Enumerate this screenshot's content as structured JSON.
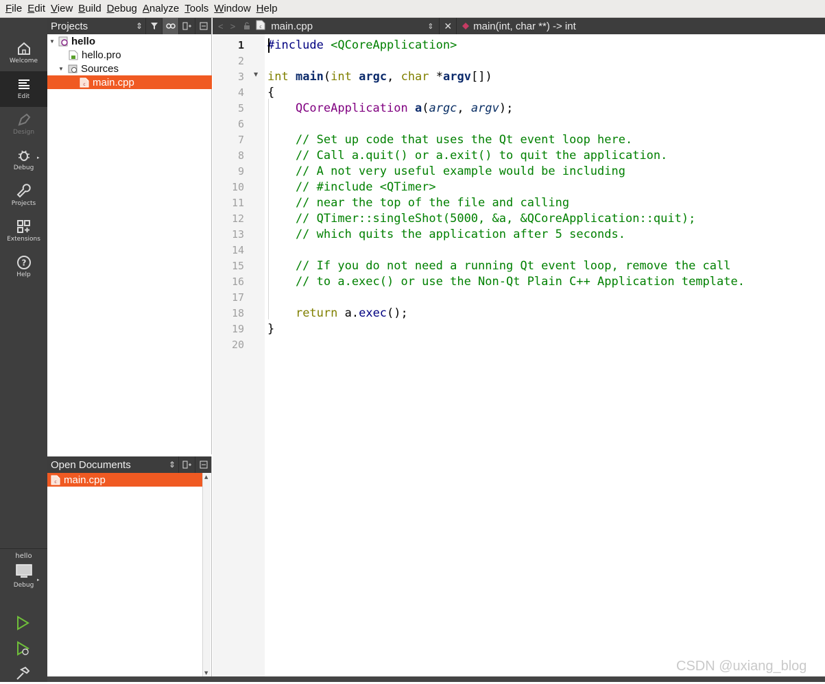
{
  "menubar": {
    "items": [
      "File",
      "Edit",
      "View",
      "Build",
      "Debug",
      "Analyze",
      "Tools",
      "Window",
      "Help"
    ]
  },
  "modes": {
    "welcome": "Welcome",
    "edit": "Edit",
    "design": "Design",
    "debug": "Debug",
    "projects": "Projects",
    "extensions": "Extensions",
    "help": "Help"
  },
  "kit": {
    "project": "hello",
    "build": "Debug"
  },
  "projects_pane": {
    "title": "Projects",
    "tree": [
      {
        "label": "hello",
        "level": 0,
        "expanded": true,
        "bold": true
      },
      {
        "label": "hello.pro",
        "level": 1
      },
      {
        "label": "Sources",
        "level": 1,
        "expanded": true
      },
      {
        "label": "main.cpp",
        "level": 2,
        "selected": true
      }
    ]
  },
  "open_documents": {
    "title": "Open Documents",
    "items": [
      "main.cpp"
    ]
  },
  "editor": {
    "file_name": "main.cpp",
    "symbol": "main(int, char **) -> int",
    "current_line": 1,
    "line_numbers": [
      "1",
      "2",
      "3",
      "4",
      "5",
      "6",
      "7",
      "8",
      "9",
      "10",
      "11",
      "12",
      "13",
      "14",
      "15",
      "16",
      "17",
      "18",
      "19",
      "20"
    ]
  },
  "code": {
    "l1_pp": "#include",
    "l1_inc": " <QCoreApplication>",
    "l3_a": "int",
    "l3_b": " ",
    "l3_c": "main",
    "l3_d": "(",
    "l3_e": "int",
    "l3_f": " ",
    "l3_g": "argc",
    "l3_h": ", ",
    "l3_i": "char",
    "l3_j": " *",
    "l3_k": "argv",
    "l3_l": "[])",
    "l4": "{",
    "l5_a": "    ",
    "l5_b": "QCoreApplication",
    "l5_c": " ",
    "l5_d": "a",
    "l5_e": "(",
    "l5_f": "argc",
    "l5_g": ", ",
    "l5_h": "argv",
    "l5_i": ");",
    "l7": "    // Set up code that uses the Qt event loop here.",
    "l8": "    // Call a.quit() or a.exit() to quit the application.",
    "l9": "    // A not very useful example would be including",
    "l10": "    // #include <QTimer>",
    "l11": "    // near the top of the file and calling",
    "l12": "    // QTimer::singleShot(5000, &a, &QCoreApplication::quit);",
    "l13": "    // which quits the application after 5 seconds.",
    "l15": "    // If you do not need a running Qt event loop, remove the call",
    "l16": "    // to a.exec() or use the Non-Qt Plain C++ Application template.",
    "l18_a": "    ",
    "l18_b": "return",
    "l18_c": " a.",
    "l18_d": "exec",
    "l18_e": "();",
    "l19": "}"
  },
  "watermark": "CSDN @uxiang_blog",
  "colors": {
    "accent": "#f05a22",
    "sidebar": "#3e3e3e",
    "keyword": "#808000",
    "comment": "#008000",
    "class": "#800080"
  }
}
